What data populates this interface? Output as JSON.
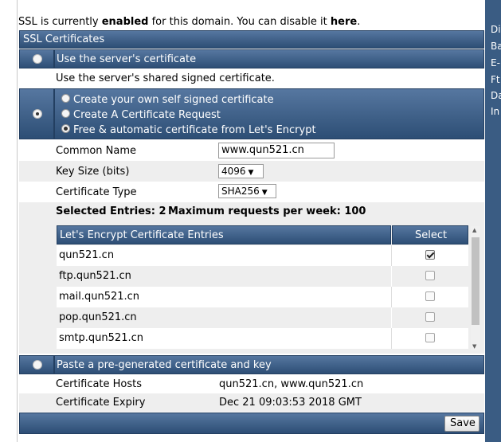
{
  "notice": {
    "prefix": "SSL is currently ",
    "status": "enabled",
    "middle": " for this domain. You can disable it ",
    "link": "here",
    "suffix": "."
  },
  "section_title": "SSL Certificates",
  "options": {
    "server_cert": {
      "label": "Use the server's certificate",
      "description": "Use the server's shared signed certificate.",
      "selected": false
    },
    "own_cert": {
      "selected": true,
      "choices": [
        {
          "label": "Create your own self signed certificate",
          "selected": false
        },
        {
          "label": "Create A Certificate Request",
          "selected": false
        },
        {
          "label": "Free & automatic certificate from Let's Encrypt",
          "selected": true
        }
      ]
    },
    "paste_cert": {
      "label": "Paste a pre-generated certificate and key",
      "selected": false
    }
  },
  "form": {
    "common_name_label": "Common Name",
    "common_name_value": "www.qun521.cn",
    "key_size_label": "Key Size (bits)",
    "key_size_value": "4096",
    "cert_type_label": "Certificate Type",
    "cert_type_value": "SHA256"
  },
  "summary": {
    "selected_entries": "Selected Entries: 2",
    "max_requests": "Maximum requests per week: 100"
  },
  "entries_table": {
    "headers": [
      "Let's Encrypt Certificate Entries",
      "Select"
    ],
    "rows": [
      {
        "domain": "qun521.cn",
        "checked": true
      },
      {
        "domain": "ftp.qun521.cn",
        "checked": false
      },
      {
        "domain": "mail.qun521.cn",
        "checked": false
      },
      {
        "domain": "pop.qun521.cn",
        "checked": false
      },
      {
        "domain": "smtp.qun521.cn",
        "checked": false
      }
    ]
  },
  "cert_info": {
    "hosts_label": "Certificate Hosts",
    "hosts_value": "qun521.cn, www.qun521.cn",
    "expiry_label": "Certificate Expiry",
    "expiry_value": "Dec 21 09:03:53 2018 GMT"
  },
  "save_label": "Save",
  "right_nav": [
    "Di",
    "Ba",
    "E-",
    "Ft",
    "Da",
    "In"
  ],
  "colors": {
    "header_top": "#5677a0",
    "header_bottom": "#2d4e75",
    "alt_row": "#eeeeee"
  }
}
